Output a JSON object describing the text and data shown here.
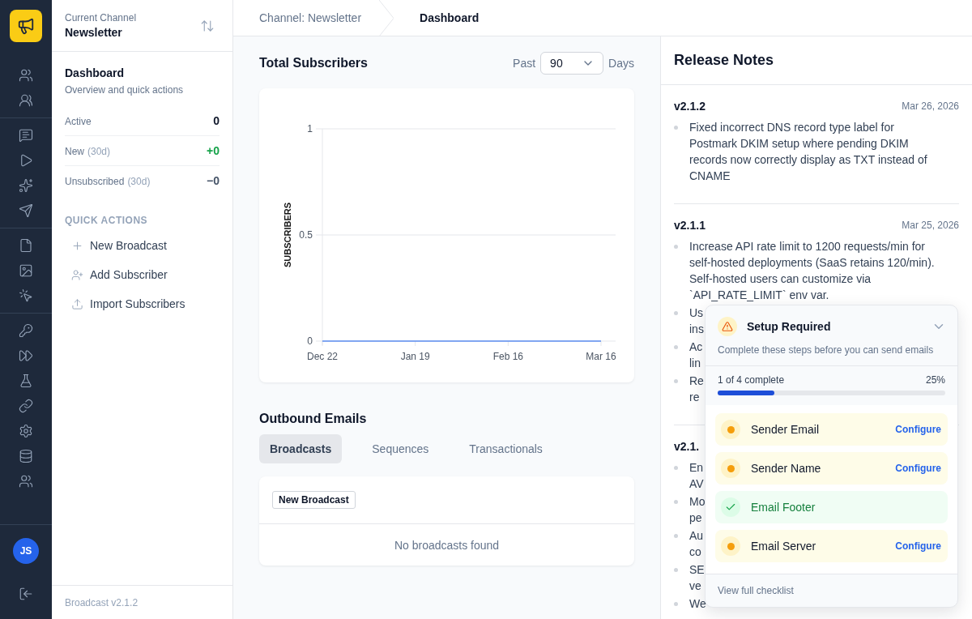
{
  "channel": {
    "caption": "Current Channel",
    "name": "Newsletter"
  },
  "sidebar": {
    "title": "Dashboard",
    "subtitle": "Overview and quick actions",
    "stats": [
      {
        "label": "Active",
        "value": "0",
        "color": "#0f172a"
      },
      {
        "label": "New",
        "suffix": "(30d)",
        "value": "+0",
        "color": "#16a34a"
      },
      {
        "label": "Unsubscribed",
        "suffix": "(30d)",
        "value": "−0",
        "color": "#475569"
      }
    ],
    "quick_actions_title": "QUICK ACTIONS",
    "quick_actions": [
      {
        "kind": "plus",
        "label": "New Broadcast"
      },
      {
        "kind": "user",
        "label": "Add Subscriber"
      },
      {
        "kind": "upload",
        "label": "Import Subscribers"
      }
    ],
    "footer": "Broadcast v2.1.2"
  },
  "user": {
    "initials": "JS"
  },
  "breadcrumb": [
    {
      "label": "Channel: Newsletter",
      "selected": false
    },
    {
      "label": "Dashboard",
      "selected": true
    }
  ],
  "subscribers": {
    "title": "Total Subscribers",
    "range_prefix": "Past",
    "range_value": "90",
    "range_suffix": "Days",
    "chart_data": {
      "type": "line",
      "ylabel": "SUBSCRIBERS",
      "categories": [
        "Dec 22",
        "Jan 19",
        "Feb 16",
        "Mar 16"
      ],
      "ylim": [
        0,
        1
      ],
      "yticks": [
        0,
        0.5,
        1
      ],
      "series": [
        {
          "color": "#5b8def",
          "values": [
            0,
            0,
            0,
            0
          ]
        }
      ]
    }
  },
  "outbound": {
    "title": "Outbound Emails",
    "tabs": [
      {
        "label": "Broadcasts",
        "selected": true
      },
      {
        "label": "Sequences",
        "selected": false
      },
      {
        "label": "Transactionals",
        "selected": false
      }
    ],
    "button": "New Broadcast",
    "empty": "No broadcasts found"
  },
  "release_notes": {
    "title": "Release Notes",
    "entries": [
      {
        "version": "v2.1.2",
        "date": "Mar 26, 2026",
        "items": [
          [
            "Fixed incorrect DNS record type label for Postmark DKIM setup where pending DKIM records now correctly display as TXT instead of CNAME"
          ]
        ]
      },
      {
        "version": "v2.1.1",
        "date": "Mar 25, 2026",
        "items": [
          [
            "Increase API rate limit to 1200 requests/min for self-hosted deployments (SaaS retains 120/min). Self-hosted users can customize via `API_RATE_LIMIT` env var."
          ],
          [
            "Us",
            "ins"
          ],
          [
            "Ac",
            "lin"
          ],
          [
            "Re",
            "re"
          ]
        ]
      },
      {
        "version": "v2.1.",
        "items": [
          [
            "En",
            "AV"
          ],
          [
            "Mo",
            "pe"
          ],
          [
            "Au",
            "co"
          ],
          [
            "SE",
            "ve"
          ],
          [
            "We"
          ]
        ]
      }
    ]
  },
  "setup": {
    "title": "Setup Required",
    "subtitle": "Complete these steps before you can send emails",
    "progress_text": "1 of 4 complete",
    "percent": "25%",
    "level": 0.25,
    "steps": [
      {
        "label": "Sender Email",
        "done": false,
        "action": "Configure"
      },
      {
        "label": "Sender Name",
        "done": false,
        "action": "Configure"
      },
      {
        "label": "Email Footer",
        "done": true
      },
      {
        "label": "Email Server",
        "done": false,
        "action": "Configure"
      }
    ],
    "footer_link": "View full checklist"
  }
}
